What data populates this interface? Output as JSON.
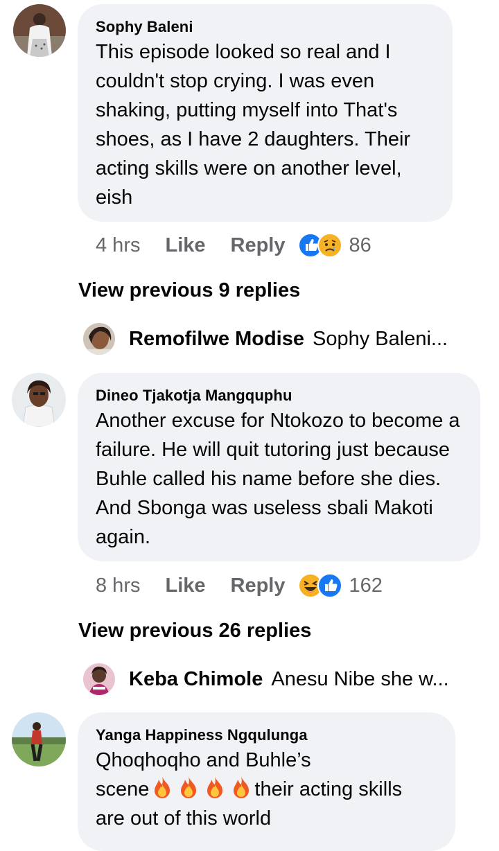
{
  "comments": [
    {
      "author": "Sophy Baleni",
      "text": "This episode looked so real and I couldn't stop crying. I was even shaking, putting myself into That's shoes, as I have 2 daughters. Their acting skills were on another level, eish",
      "time": "4 hrs",
      "like_label": "Like",
      "reply_label": "Reply",
      "reaction_count": "86",
      "reactions": [
        "like-icon",
        "sad-icon"
      ],
      "view_previous": "View previous 9 replies",
      "latest_reply": {
        "name": "Remofilwe Modise",
        "text": "Sophy Baleni..."
      }
    },
    {
      "author": "Dineo Tjakotja Mangquphu",
      "text": "Another excuse for Ntokozo to become a failure. He will quit tutoring just because Buhle called his name before she dies. And Sbonga was useless sbali Makoti again.",
      "time": "8 hrs",
      "like_label": "Like",
      "reply_label": "Reply",
      "reaction_count": "162",
      "reactions": [
        "haha-icon",
        "like-icon"
      ],
      "view_previous": "View previous 26 replies",
      "latest_reply": {
        "name": "Keba Chimole",
        "text": "Anesu Nibe she w..."
      }
    },
    {
      "author": "Yanga Happiness Ngqulunga",
      "text_line1": "Qhoqhoqho and Buhle’s",
      "text_line2_start": "scene",
      "text_line2_end": "their acting skills",
      "text_line3": "are out of this world",
      "emoji": [
        "fire-icon",
        "fire-icon",
        "fire-icon",
        "fire-icon"
      ]
    }
  ],
  "colors": {
    "bubble": "#f0f2f5",
    "meta_text": "#65676b",
    "like_blue": "#1877f2",
    "reaction_yellow": "#f7b125"
  }
}
